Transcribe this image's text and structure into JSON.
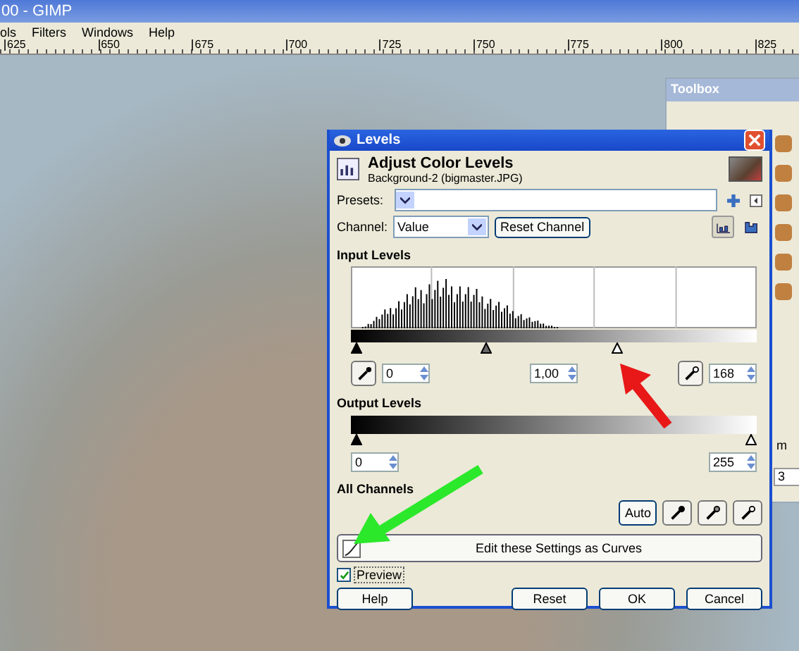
{
  "app_window": {
    "title": "00 - GIMP"
  },
  "menu": [
    {
      "label": "ols"
    },
    {
      "label": "Filters"
    },
    {
      "label": "Windows"
    },
    {
      "label": "Help"
    }
  ],
  "ruler": {
    "labels": [
      "625",
      "650",
      "675",
      "700",
      "725",
      "750",
      "775",
      "800",
      "825"
    ]
  },
  "toolbox": {
    "title": "Toolbox",
    "unit_text": "m",
    "field_value": "3"
  },
  "dialog": {
    "title": "Levels",
    "heading": "Adjust Color Levels",
    "subheading": "Background-2 (bigmaster.JPG)",
    "presets_label": "Presets:",
    "channel": {
      "label": "Channel:",
      "value": "Value",
      "reset_button": "Reset Channel"
    },
    "scale_toggles": [
      {
        "kind": "linear",
        "selected": true
      },
      {
        "kind": "log",
        "selected": false
      }
    ],
    "input_levels": {
      "title": "Input Levels",
      "handles": [
        {
          "kind": "black",
          "level": 0
        },
        {
          "kind": "gray",
          "level": 0.33
        },
        {
          "kind": "white",
          "level": 0.66
        }
      ],
      "low": "0",
      "gamma": "1,00",
      "high": "168"
    },
    "output_levels": {
      "title": "Output Levels",
      "handles": [
        {
          "kind": "black",
          "level": 0
        },
        {
          "kind": "white",
          "level": 1
        }
      ],
      "low": "0",
      "high": "255"
    },
    "all_channels": {
      "title": "All Channels",
      "auto_button": "Auto"
    },
    "curves_button": "Edit these Settings as Curves",
    "preview": {
      "label": "Preview",
      "checked": true
    },
    "buttons": [
      "Help",
      "Reset",
      "OK",
      "Cancel"
    ]
  }
}
